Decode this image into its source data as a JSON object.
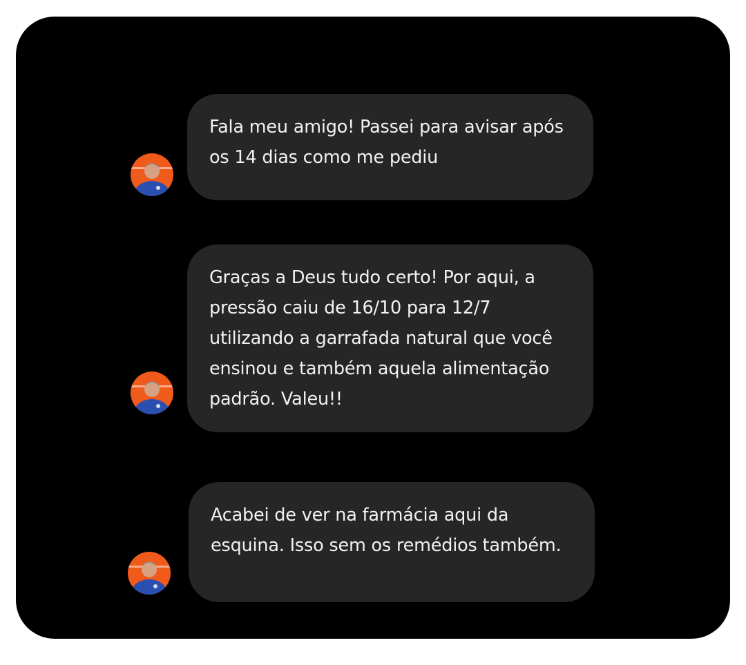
{
  "chat": {
    "messages": [
      {
        "text": "Fala meu amigo! Passei para avisar após os 14 dias como me pediu",
        "avatar_icon": "user-avatar-photo"
      },
      {
        "text": "Graças a Deus tudo certo! Por aqui, a pressão caiu de 16/10 para 12/7 utilizando a garrafada natural que você ensinou e também aquela alimentação padrão. Valeu!!",
        "avatar_icon": "user-avatar-photo"
      },
      {
        "text": "Acabei de ver na farmácia aqui da esquina. Isso sem os remédios também.",
        "avatar_icon": "user-avatar-photo"
      }
    ]
  },
  "colors": {
    "page_background": "#ffffff",
    "card_background": "#000000",
    "bubble_background": "#262626",
    "bubble_text": "#f2f2f2",
    "avatar_background": "#f05a1a",
    "avatar_shirt": "#2a4fb0"
  }
}
